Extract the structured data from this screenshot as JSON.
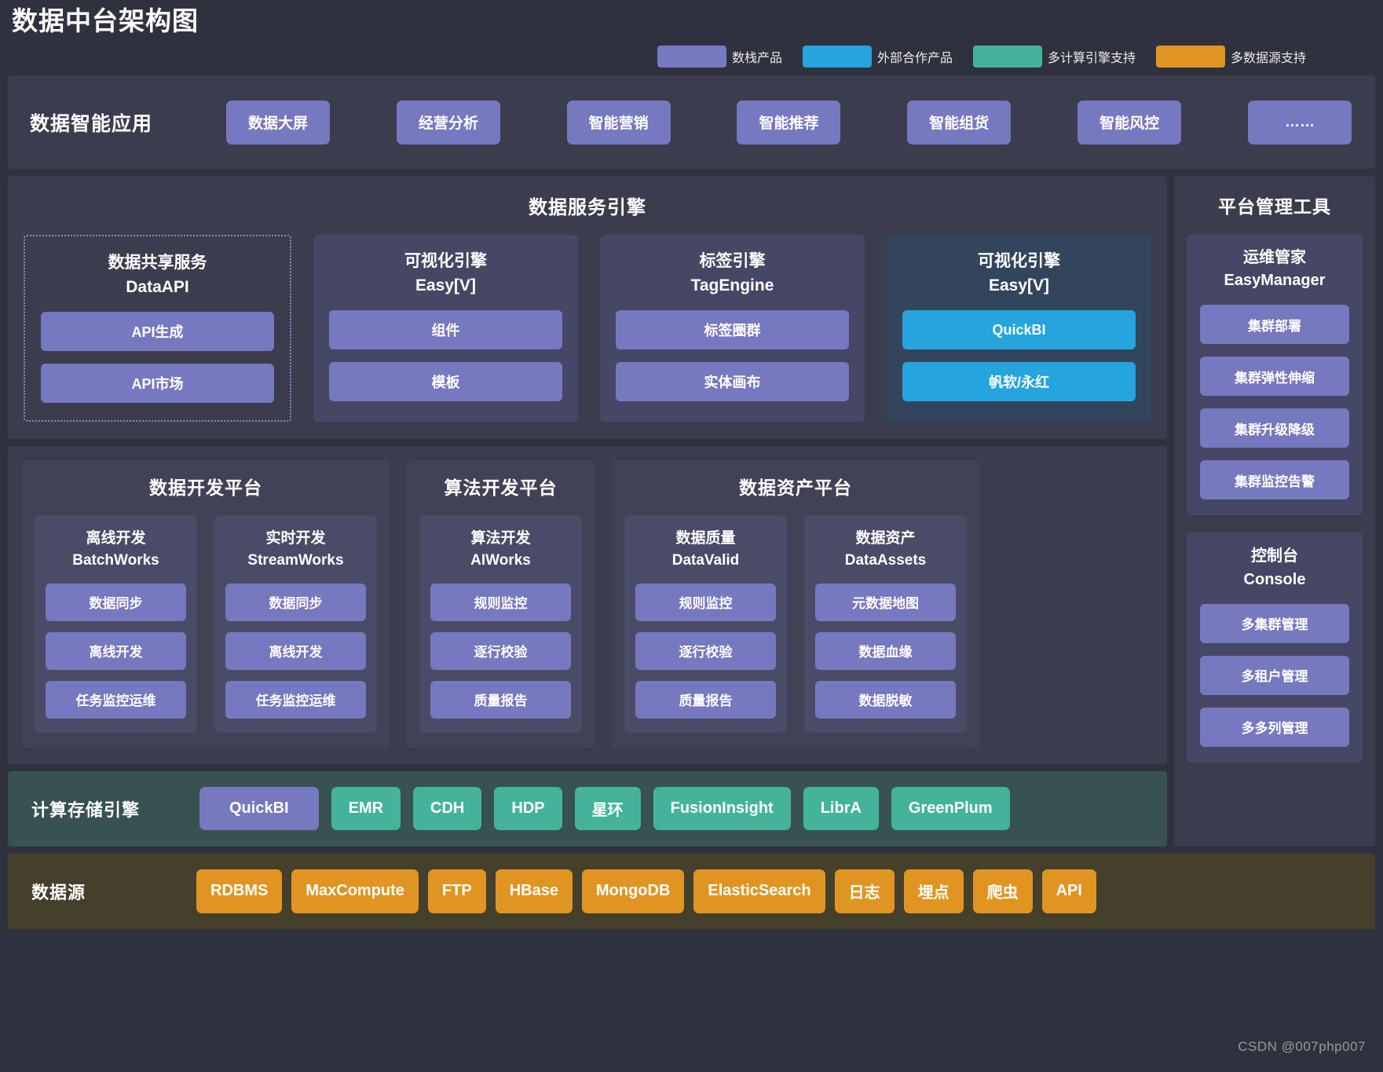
{
  "title": "数据中台架构图",
  "legend": [
    {
      "label": "数栈产品",
      "color": "#7678c0"
    },
    {
      "label": "外部合作产品",
      "color": "#25a4de"
    },
    {
      "label": "多计算引擎支持",
      "color": "#45b39b"
    },
    {
      "label": "多数据源支持",
      "color": "#e09522"
    }
  ],
  "apps": {
    "title": "数据智能应用",
    "items": [
      "数据大屏",
      "经营分析",
      "智能营销",
      "智能推荐",
      "智能组货",
      "智能风控",
      "……"
    ]
  },
  "data_service_engine": {
    "title": "数据服务引擎",
    "cards": [
      {
        "style": "dashed",
        "name_cn": "数据共享服务",
        "name_en": "DataAPI",
        "items": [
          {
            "label": "API生成",
            "color": "purple"
          },
          {
            "label": "API市场",
            "color": "purple"
          }
        ]
      },
      {
        "style": "solid",
        "name_cn": "可视化引擎",
        "name_en": "Easy[V]",
        "items": [
          {
            "label": "组件",
            "color": "purple"
          },
          {
            "label": "模板",
            "color": "purple"
          }
        ]
      },
      {
        "style": "solid",
        "name_cn": "标签引擎",
        "name_en": "TagEngine",
        "items": [
          {
            "label": "标签圈群",
            "color": "purple"
          },
          {
            "label": "实体画布",
            "color": "purple"
          }
        ]
      },
      {
        "style": "blue",
        "name_cn": "可视化引擎",
        "name_en": "Easy[V]",
        "items": [
          {
            "label": "QuickBI",
            "color": "blue"
          },
          {
            "label": "帆软/永红",
            "color": "blue"
          }
        ]
      }
    ]
  },
  "platforms": [
    {
      "title": "数据开发平台",
      "columns": [
        {
          "name_cn": "离线开发",
          "name_en": "BatchWorks",
          "items": [
            "数据同步",
            "离线开发",
            "任务监控运维"
          ]
        },
        {
          "name_cn": "实时开发",
          "name_en": "StreamWorks",
          "items": [
            "数据同步",
            "离线开发",
            "任务监控运维"
          ]
        }
      ]
    },
    {
      "title": "算法开发平台",
      "columns": [
        {
          "name_cn": "算法开发",
          "name_en": "AIWorks",
          "items": [
            "规则监控",
            "逐行校验",
            "质量报告"
          ]
        }
      ]
    },
    {
      "title": "数据资产平台",
      "columns": [
        {
          "name_cn": "数据质量",
          "name_en": "DataValid",
          "items": [
            "规则监控",
            "逐行校验",
            "质量报告"
          ]
        },
        {
          "name_cn": "数据资产",
          "name_en": "DataAssets",
          "items": [
            "元数据地图",
            "数据血缘",
            "数据脱敏"
          ]
        }
      ]
    }
  ],
  "engines": {
    "title": "计算存储引擎",
    "items": [
      {
        "label": "QuickBI",
        "color": "purple"
      },
      {
        "label": "EMR",
        "color": "green"
      },
      {
        "label": "CDH",
        "color": "green"
      },
      {
        "label": "HDP",
        "color": "green"
      },
      {
        "label": "星环",
        "color": "green"
      },
      {
        "label": "FusionInsight",
        "color": "green"
      },
      {
        "label": "LibrA",
        "color": "green"
      },
      {
        "label": "GreenPlum",
        "color": "green"
      }
    ]
  },
  "platform_tools": {
    "title": "平台管理工具",
    "cards": [
      {
        "name_cn": "运维管家",
        "name_en": "EasyManager",
        "items": [
          "集群部署",
          "集群弹性伸缩",
          "集群升级降级",
          "集群监控告警"
        ]
      },
      {
        "name_cn": "控制台",
        "name_en": "Console",
        "items": [
          "多集群管理",
          "多租户管理",
          "多多列管理"
        ]
      }
    ]
  },
  "sources": {
    "title": "数据源",
    "items": [
      "RDBMS",
      "MaxCompute",
      "FTP",
      "HBase",
      "MongoDB",
      "ElasticSearch",
      "日志",
      "埋点",
      "爬虫",
      "API"
    ]
  },
  "watermark": "CSDN @007php007"
}
